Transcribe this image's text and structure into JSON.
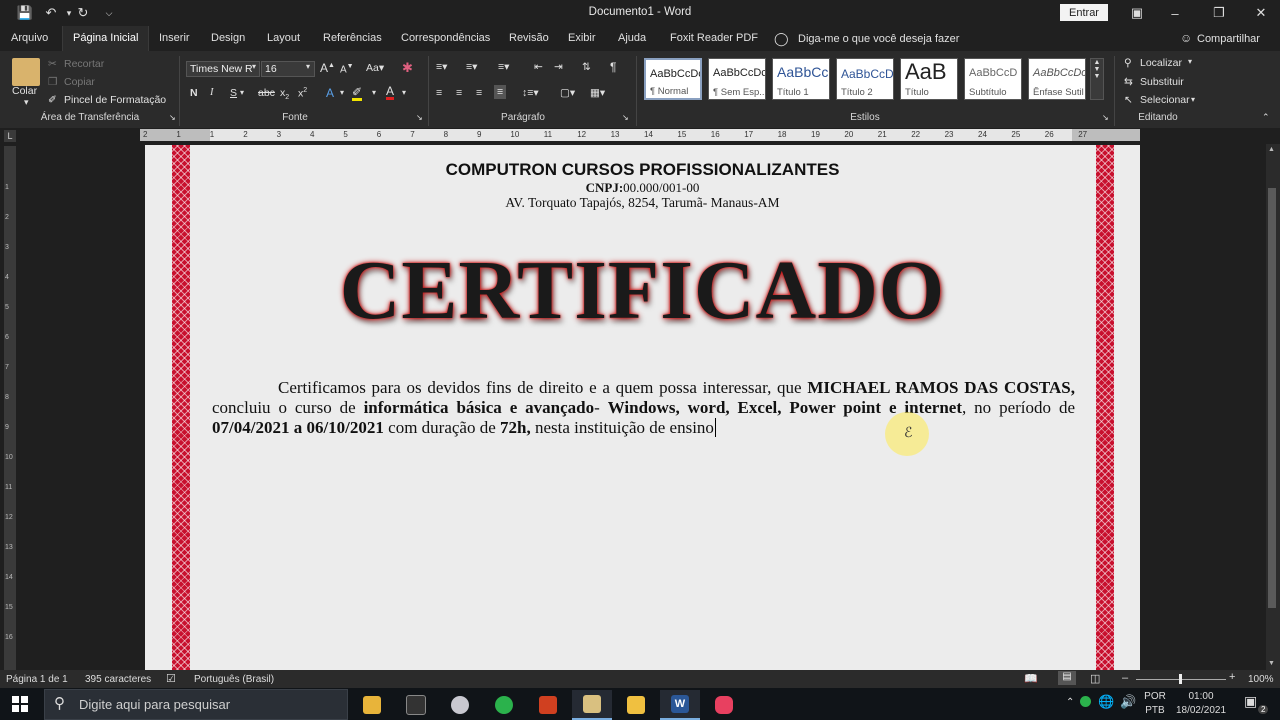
{
  "titlebar": {
    "document_title": "Documento1  -  Word",
    "sign_in": "Entrar"
  },
  "tabs": [
    "Arquivo",
    "Página Inicial",
    "Inserir",
    "Design",
    "Layout",
    "Referências",
    "Correspondências",
    "Revisão",
    "Exibir",
    "Ajuda",
    "Foxit Reader PDF"
  ],
  "tell_me": "Diga-me o que você deseja fazer",
  "share": "Compartilhar",
  "ribbon": {
    "clipboard": {
      "paste": "Colar",
      "cut": "Recortar",
      "copy": "Copiar",
      "format_painter": "Pincel de Formatação",
      "label": "Área de Transferência"
    },
    "font": {
      "name": "Times New R",
      "size": "16",
      "label": "Fonte",
      "bold": "N",
      "italic": "I",
      "underline": "S",
      "strike": "abc"
    },
    "paragraph": {
      "label": "Parágrafo"
    },
    "styles": {
      "label": "Estilos",
      "items": [
        {
          "sample": "AaBbCcDc",
          "name": "¶ Normal"
        },
        {
          "sample": "AaBbCcDc",
          "name": "¶ Sem Esp..."
        },
        {
          "sample": "AaBbCc",
          "name": "Título 1"
        },
        {
          "sample": "AaBbCcD",
          "name": "Título 2"
        },
        {
          "sample": "AaB",
          "name": "Título"
        },
        {
          "sample": "AaBbCcD",
          "name": "Subtítulo"
        },
        {
          "sample": "AaBbCcDc",
          "name": "Ênfase Sutil"
        }
      ]
    },
    "editing": {
      "find": "Localizar",
      "replace": "Substituir",
      "select": "Selecionar",
      "label": "Editando"
    }
  },
  "ruler_numbers": [
    "2",
    "1",
    "1",
    "2",
    "3",
    "4",
    "5",
    "6",
    "7",
    "8",
    "9",
    "10",
    "11",
    "12",
    "13",
    "14",
    "15",
    "16",
    "17",
    "18",
    "19",
    "20",
    "21",
    "22",
    "23",
    "24",
    "25",
    "26",
    "27"
  ],
  "vruler_numbers": [
    "1",
    "2",
    "3",
    "4",
    "5",
    "6",
    "7",
    "8",
    "9",
    "10",
    "11",
    "12",
    "13",
    "14",
    "15",
    "16"
  ],
  "document": {
    "company": "COMPUTRON CURSOS PROFISSIONALIZANTES",
    "cnpj_label": "CNPJ:",
    "cnpj_value": "00.000/001-00",
    "address": "AV. Torquato Tapajós, 8254, Tarumã- Manaus-AM",
    "title": "CERTIFICADO",
    "body": {
      "p1": "Certificamos para os devidos fins de direito e a quem possa interessar, que ",
      "name": "MICHAEL RAMOS DAS COSTAS,",
      "p2": " concluiu o curso de ",
      "course": "informática básica e avançado",
      "p3": "- ",
      "modules": "Windows, word, Excel, Power point e internet",
      "p4": ", no período de ",
      "period": "07/04/2021 a 06/10/2021",
      "p5": " com duração de ",
      "duration": "72h,",
      "p6": " nesta instituição de ensino"
    }
  },
  "statusbar": {
    "page": "Página 1 de 1",
    "chars": "395 caracteres",
    "language": "Português (Brasil)",
    "zoom": "100%"
  },
  "taskbar": {
    "search_placeholder": "Digite aqui para pesquisar",
    "lang": "POR",
    "layout": "PTB",
    "time": "01:00",
    "date": "18/02/2021",
    "notifications": "2"
  }
}
